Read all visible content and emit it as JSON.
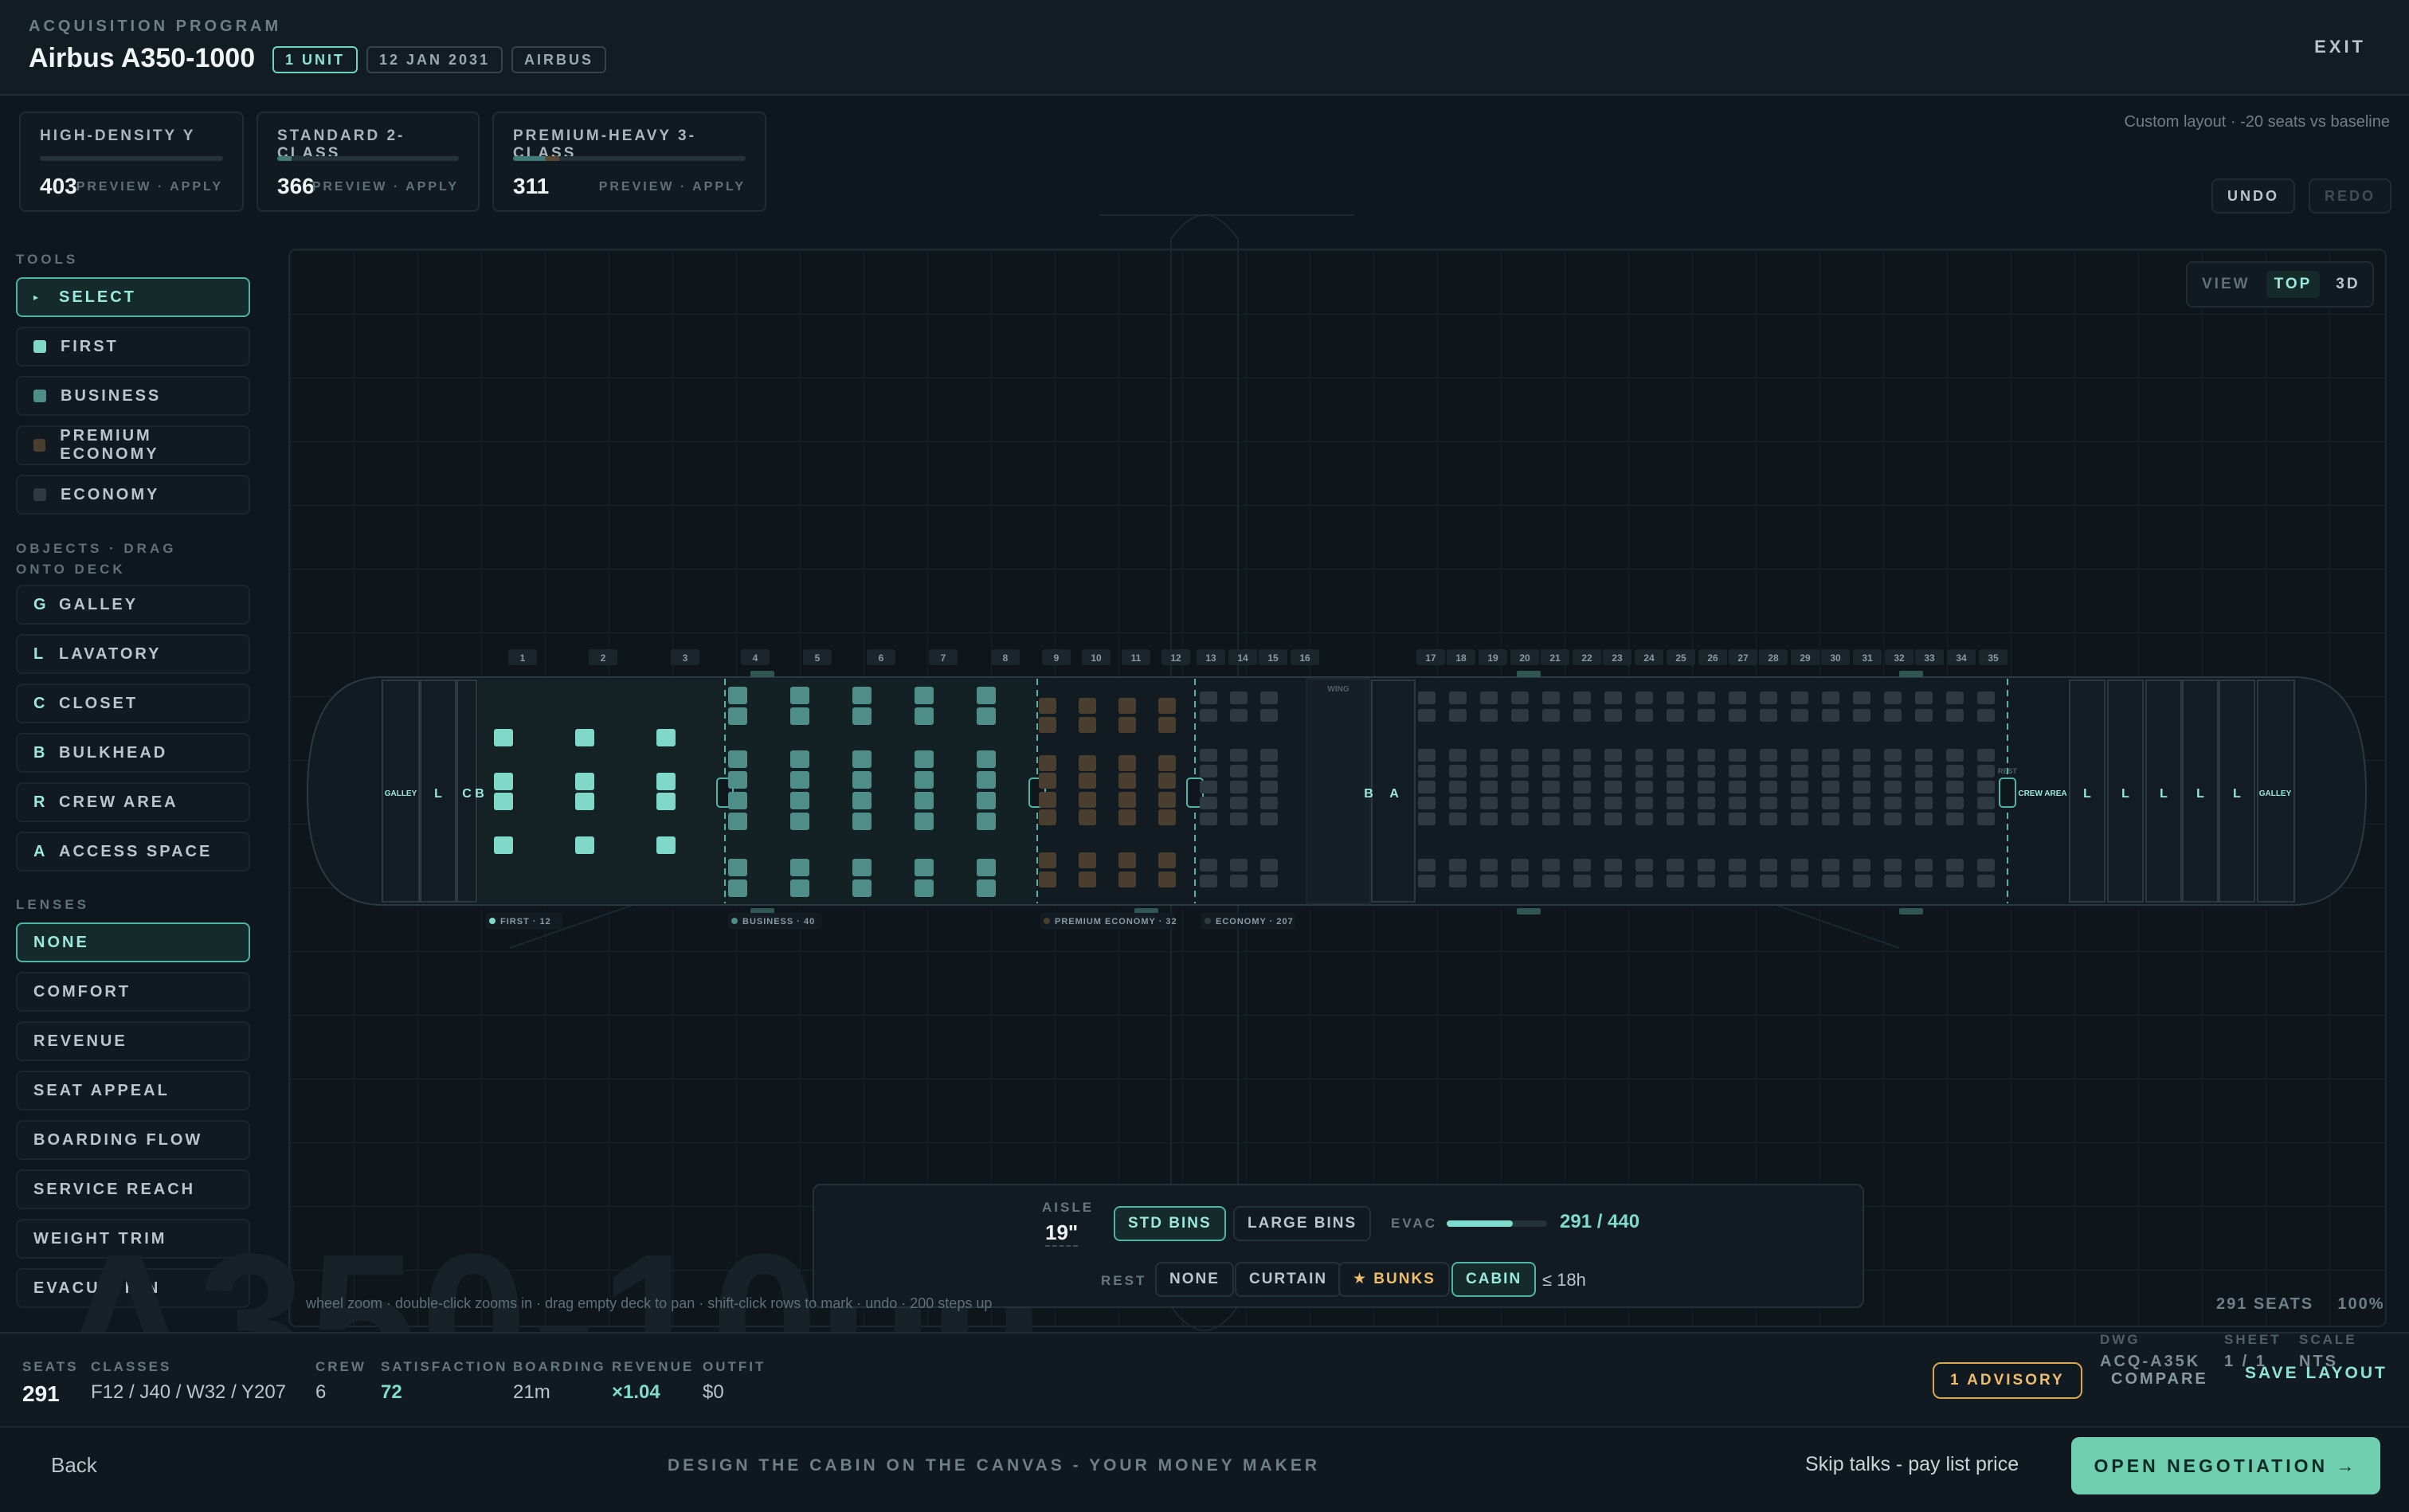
{
  "header": {
    "kicker": "ACQUISITION PROGRAM",
    "title": "Airbus A350-1000",
    "chips": [
      "1 UNIT",
      "12 JAN 2031",
      "AIRBUS"
    ],
    "exit": "EXIT"
  },
  "presets": [
    {
      "name": "HIGH-DENSITY Y",
      "count": "403",
      "action": "PREVIEW · APPLY",
      "fill": 0.0
    },
    {
      "name": "STANDARD 2-CLASS",
      "count": "366",
      "action": "PREVIEW · APPLY",
      "fill": 0.08
    },
    {
      "name": "PREMIUM-HEAVY 3-CLASS",
      "count": "311",
      "action": "PREVIEW · APPLY",
      "fill": 0.2
    }
  ],
  "layout_note": "Custom layout · -20 seats vs baseline",
  "history": {
    "undo": "UNDO",
    "redo": "REDO"
  },
  "tools": {
    "heading": "TOOLS",
    "items": [
      {
        "label": "SELECT",
        "icon": "caret-right-icon"
      },
      {
        "label": "FIRST",
        "color": "#7fd8c8"
      },
      {
        "label": "BUSINESS",
        "color": "#4f8e88"
      },
      {
        "label": "PREMIUM ECONOMY",
        "color": "#4a3f2f"
      },
      {
        "label": "ECONOMY",
        "color": "#2f3a40"
      }
    ]
  },
  "objects": {
    "heading": "OBJECTS · DRAG ONTO DECK",
    "items": [
      {
        "key": "G",
        "label": "GALLEY"
      },
      {
        "key": "L",
        "label": "LAVATORY"
      },
      {
        "key": "C",
        "label": "CLOSET"
      },
      {
        "key": "B",
        "label": "BULKHEAD"
      },
      {
        "key": "R",
        "label": "CREW AREA"
      },
      {
        "key": "A",
        "label": "ACCESS SPACE"
      }
    ]
  },
  "lenses": {
    "heading": "LENSES",
    "items": [
      "NONE",
      "COMFORT",
      "REVENUE",
      "SEAT APPEAL",
      "BOARDING FLOW",
      "SERVICE REACH",
      "WEIGHT TRIM",
      "EVACUATION"
    ]
  },
  "view": {
    "label": "VIEW",
    "top": "TOP",
    "three_d": "3D"
  },
  "deck": {
    "rows": [
      "1",
      "2",
      "3",
      "4",
      "5",
      "6",
      "7",
      "8",
      "9",
      "10",
      "11",
      "12",
      "13",
      "14",
      "15",
      "16",
      "17",
      "18",
      "19",
      "20",
      "21",
      "22",
      "23",
      "24",
      "25",
      "26",
      "27",
      "28",
      "29",
      "30",
      "31",
      "32",
      "33",
      "34",
      "35"
    ],
    "fwd_labels": [
      "GALLEY",
      "L",
      "C",
      "B"
    ],
    "mid_labels": [
      "B",
      "A"
    ],
    "wing_label": "WING",
    "aft_labels": [
      "CREW AREA",
      "L",
      "L",
      "L",
      "L",
      "L",
      "GALLEY"
    ],
    "rest_label": "REST",
    "cabins": [
      {
        "label": "FIRST · 12",
        "color": "#7fd8c8"
      },
      {
        "label": "BUSINESS · 40",
        "color": "#4f8e88"
      },
      {
        "label": "PREMIUM ECONOMY · 32",
        "color": "#4a3f2f"
      },
      {
        "label": "ECONOMY · 207",
        "color": "#2f3a40"
      }
    ]
  },
  "panel": {
    "aisle_label": "AISLE",
    "aisle_value": "19\"",
    "bins": [
      "STD BINS",
      "LARGE BINS"
    ],
    "evac_label": "EVAC",
    "evac_value": "291 / 440",
    "evac_fraction": 0.66,
    "rest_label": "REST",
    "rest_options": [
      "NONE",
      "CURTAIN",
      "★ BUNKS",
      "CABIN"
    ],
    "rest_limit": "≤ 18h"
  },
  "hint": "wheel zoom · double-click zooms in · drag empty deck to pan · shift-click rows to mark · undo · 200 steps up",
  "zoom": {
    "seats": "291 SEATS",
    "percent": "100%"
  },
  "watermark": "A350-1000",
  "stats": [
    {
      "label": "SEATS",
      "value": "291"
    },
    {
      "label": "CLASSES",
      "value": "F12 / J40 / W32 / Y207"
    },
    {
      "label": "CREW",
      "value": "6"
    },
    {
      "label": "SATISFACTION",
      "value": "72"
    },
    {
      "label": "BOARDING",
      "value": "21m"
    },
    {
      "label": "REVENUE",
      "value": "×1.04"
    },
    {
      "label": "OUTFIT",
      "value": "$0"
    }
  ],
  "advisory": "1 ADVISORY",
  "drawing": {
    "dwg_label": "DWG",
    "dwg_value": "ACQ-A35K",
    "sheet_label": "SHEET",
    "sheet_value": "1 / 1",
    "scale_label": "SCALE",
    "scale_value": "NTS",
    "compare": "COMPARE",
    "save": "SAVE LAYOUT"
  },
  "footer": {
    "back": "Back",
    "message": "DESIGN THE CABIN ON THE CANVAS - YOUR MONEY MAKER",
    "skip": "Skip talks - pay list price",
    "negotiate": "OPEN NEGOTIATION →"
  }
}
